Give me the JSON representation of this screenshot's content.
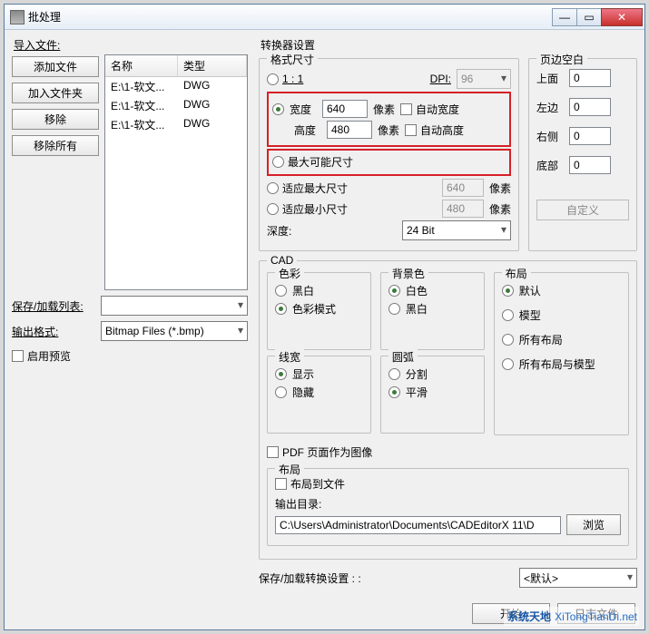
{
  "window": {
    "title": "批处理"
  },
  "left": {
    "import_label": "导入文件:",
    "add_file": "添加文件",
    "add_folder": "加入文件夹",
    "remove": "移除",
    "remove_all": "移除所有",
    "cols": {
      "name": "名称",
      "type": "类型"
    },
    "rows": [
      {
        "name": "E:\\1-软文...",
        "type": "DWG"
      },
      {
        "name": "E:\\1-软文...",
        "type": "DWG"
      },
      {
        "name": "E:\\1-软文...",
        "type": "DWG"
      }
    ],
    "save_load_list": "保存/加载列表:",
    "output_format": "输出格式:",
    "output_format_value": "Bitmap Files (*.bmp)",
    "enable_preview": "启用预览"
  },
  "conv": {
    "title": "转换器设置",
    "format_size": "格式尺寸",
    "one_to_one": "1 : 1",
    "dpi_label": "DPI:",
    "dpi_value": "96",
    "width_label": "宽度",
    "width_value": "640",
    "height_label": "高度",
    "height_value": "480",
    "px": "像素",
    "auto_w": "自动宽度",
    "auto_h": "自动高度",
    "max_possible": "最大可能尺寸",
    "fit_max": "适应最大尺寸",
    "fit_max_val": "640",
    "fit_min": "适应最小尺寸",
    "fit_min_val": "480",
    "depth_label": "深度:",
    "depth_value": "24 Bit",
    "margins": {
      "title": "页边空白",
      "top": "上面",
      "top_v": "0",
      "left": "左边",
      "left_v": "0",
      "right": "右侧",
      "right_v": "0",
      "bottom": "底部",
      "bottom_v": "0",
      "custom": "自定义"
    },
    "cad": {
      "title": "CAD",
      "color": {
        "title": "色彩",
        "bw": "黑白",
        "mode": "色彩模式"
      },
      "bg": {
        "title": "背景色",
        "white": "白色",
        "black": "黑白"
      },
      "layout": {
        "title": "布局",
        "default": "默认",
        "model": "模型",
        "all": "所有布局",
        "all_model": "所有布局与模型"
      },
      "lw": {
        "title": "线宽",
        "show": "显示",
        "hide": "隐藏"
      },
      "arc": {
        "title": "圆弧",
        "split": "分割",
        "smooth": "平滑"
      }
    },
    "pdf_as_image": "PDF 页面作为图像",
    "out_layout": {
      "title": "布局",
      "to_file": "布局到文件",
      "dir_label": "输出目录:",
      "dir_value": "C:\\Users\\Administrator\\Documents\\CADEditorX 11\\D",
      "browse": "浏览"
    },
    "save_load_settings": "保存/加载转换设置 : :",
    "settings_value": "<默认>"
  },
  "bottom": {
    "start": "开始",
    "log": "日志文件"
  },
  "watermark": {
    "brand": "系统天地",
    "url": "XiTongTianDi.net"
  }
}
